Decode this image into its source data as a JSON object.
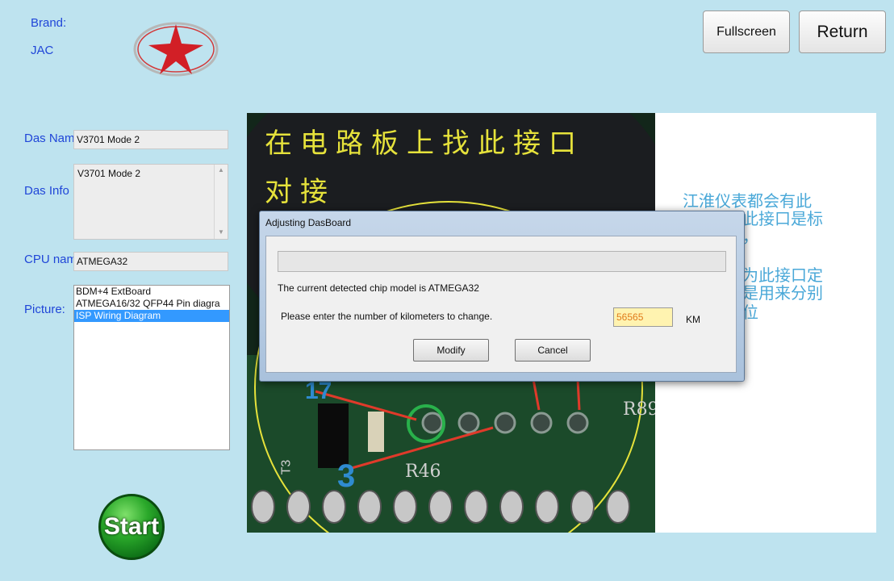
{
  "brand": {
    "label": "Brand:",
    "name": "JAC"
  },
  "top_buttons": {
    "fullscreen": "Fullscreen",
    "return": "Return"
  },
  "form": {
    "das_name_label": "Das Nam",
    "das_name_value": "V3701 Mode 2",
    "das_info_label": "Das Info",
    "das_info_value": "V3701 Mode 2",
    "cpu_label": "CPU nam",
    "cpu_value": "ATMEGA32",
    "picture_label": "Picture:",
    "picture_items": [
      {
        "label": "BDM+4 ExtBoard",
        "selected": false
      },
      {
        "label": "ATMEGA16/32 QFP44 Pin diagra",
        "selected": false
      },
      {
        "label": "ISP Wiring Diagram",
        "selected": true
      }
    ]
  },
  "photo": {
    "line1": "在电路板上找此接口",
    "line2": "对接",
    "pins": [
      "R89",
      "R46",
      "T3",
      "17",
      "3"
    ]
  },
  "side_note": {
    "lines": [
      "江淮仪表都会有此",
      "此接口是标",
      "，",
      "为此接口定",
      "是用来分别",
      "位"
    ]
  },
  "dialog": {
    "title": "Adjusting DasBoard",
    "detected_text": "The current detected chip model is ATMEGA32",
    "prompt": "Please enter the number of kilometers to change.",
    "km_value": "56565",
    "unit": "KM",
    "modify": "Modify",
    "cancel": "Cancel"
  },
  "start_label": "Start",
  "colors": {
    "background": "#bee3ef",
    "label_blue": "#2046d8",
    "selection": "#3399ff",
    "start_green": "#2aa82a"
  }
}
